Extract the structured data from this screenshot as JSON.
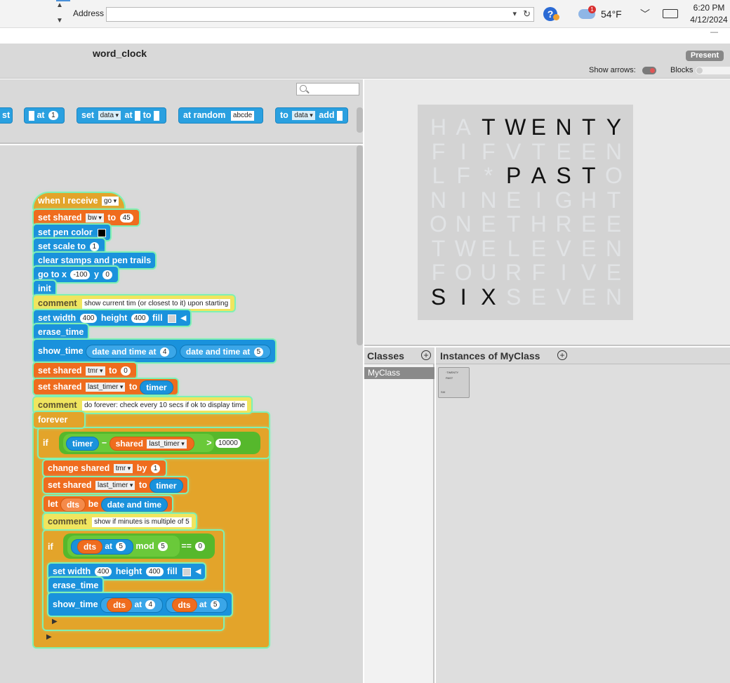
{
  "taskbar": {
    "address_label": "Address",
    "address_value": "",
    "temperature": "54°F",
    "weather_badge": "1",
    "time": "6:20 PM",
    "date": "4/12/2024",
    "help_glyph": "?"
  },
  "header": {
    "project_title": "word_clock",
    "present_label": "Present",
    "show_arrows_label": "Show arrows:",
    "blocks_label": "Blocks"
  },
  "palette": {
    "blocks": [
      {
        "label": "st"
      },
      {
        "label": "at",
        "arg": "1"
      },
      {
        "label": "set",
        "slot": "data",
        "label2": "at",
        "label3": "to"
      },
      {
        "label": "at random",
        "arg": "abcde"
      },
      {
        "label": "to",
        "slot": "data",
        "label2": "add"
      }
    ]
  },
  "script": {
    "hat": {
      "label": "when I receive",
      "arg": "go"
    },
    "b1": {
      "label": "set shared",
      "var": "bw",
      "to": "to",
      "val": "45"
    },
    "b2": {
      "label": "set pen color"
    },
    "b3": {
      "label": "set scale to",
      "val": "1"
    },
    "b4": {
      "label": "clear stamps and pen trails"
    },
    "b5": {
      "label": "go to x",
      "x": "-100",
      "y_label": "y",
      "y": "0"
    },
    "b6": {
      "label": "init"
    },
    "c1": {
      "label": "comment",
      "text": "show current tim (or closest to it) upon starting"
    },
    "b7": {
      "label": "set width",
      "w": "400",
      "h_label": "height",
      "h": "400",
      "fill": "fill"
    },
    "b8": {
      "label": "erase_time"
    },
    "b9": {
      "label": "show_time",
      "r1": "date and time",
      "at": "at",
      "v1": "4",
      "r2": "date and time",
      "v2": "5"
    },
    "b10": {
      "label": "set shared",
      "var": "tmr",
      "to": "to",
      "val": "0"
    },
    "b11": {
      "label": "set shared",
      "var": "last_timer",
      "to": "to",
      "rep": "timer"
    },
    "c2": {
      "label": "comment",
      "text": "do forever: check every 10 secs if ok to display time"
    },
    "forever": {
      "label": "forever"
    },
    "if1": {
      "label": "if",
      "r1": "timer",
      "op": "−",
      "r2": "shared",
      "var": "last_timer",
      "gt": ">",
      "val": "10000"
    },
    "b12": {
      "label": "change shared",
      "var": "tmr",
      "by": "by",
      "val": "1"
    },
    "b13": {
      "label": "set shared",
      "var": "last_timer",
      "to": "to",
      "rep": "timer"
    },
    "b14": {
      "label": "let",
      "var": "dts",
      "be": "be",
      "rep": "date and time"
    },
    "c3": {
      "label": "comment",
      "text": "show if minutes is multiple of 5"
    },
    "if2": {
      "label": "if",
      "r1": "dts",
      "at": "at",
      "v1": "5",
      "mod": "mod",
      "v2": "5",
      "eq": "==",
      "v3": "0"
    },
    "b15": {
      "label": "set width",
      "w": "400",
      "h_label": "height",
      "h": "400",
      "fill": "fill"
    },
    "b16": {
      "label": "erase_time"
    },
    "b17": {
      "label": "show_time",
      "r1": "dts",
      "at": "at",
      "v1": "4",
      "r2": "dts",
      "v2": "5"
    }
  },
  "stage": {
    "rows": [
      {
        "letters": "HATWENTY",
        "lit": [
          0,
          0,
          1,
          1,
          1,
          1,
          1,
          1
        ]
      },
      {
        "letters": "FIFVTEEN",
        "lit": [
          0,
          0,
          0,
          0,
          0,
          0,
          0,
          0
        ]
      },
      {
        "letters": "LF*PASTO",
        "lit": [
          0,
          0,
          0,
          1,
          1,
          1,
          1,
          0
        ]
      },
      {
        "letters": "NINEIGHT",
        "lit": [
          0,
          0,
          0,
          0,
          0,
          0,
          0,
          0
        ]
      },
      {
        "letters": "ONETHREE",
        "lit": [
          0,
          0,
          0,
          0,
          0,
          0,
          0,
          0
        ]
      },
      {
        "letters": "TWELEVEN",
        "lit": [
          0,
          0,
          0,
          0,
          0,
          0,
          0,
          0
        ]
      },
      {
        "letters": "FOURFIVE",
        "lit": [
          0,
          0,
          0,
          0,
          0,
          0,
          0,
          0
        ]
      },
      {
        "letters": "SIXSEVEN",
        "lit": [
          1,
          1,
          1,
          0,
          0,
          0,
          0,
          0
        ]
      }
    ]
  },
  "classes": {
    "title": "Classes",
    "items": [
      "MyClass"
    ]
  },
  "instances": {
    "title": "Instances of MyClass"
  },
  "colors": {
    "motion_blue": "#1a92dc",
    "variables_orange": "#ef6c1e",
    "control_yellow": "#e3a42a",
    "operators_green": "#56b82c",
    "highlight": "#7ff0b3"
  }
}
